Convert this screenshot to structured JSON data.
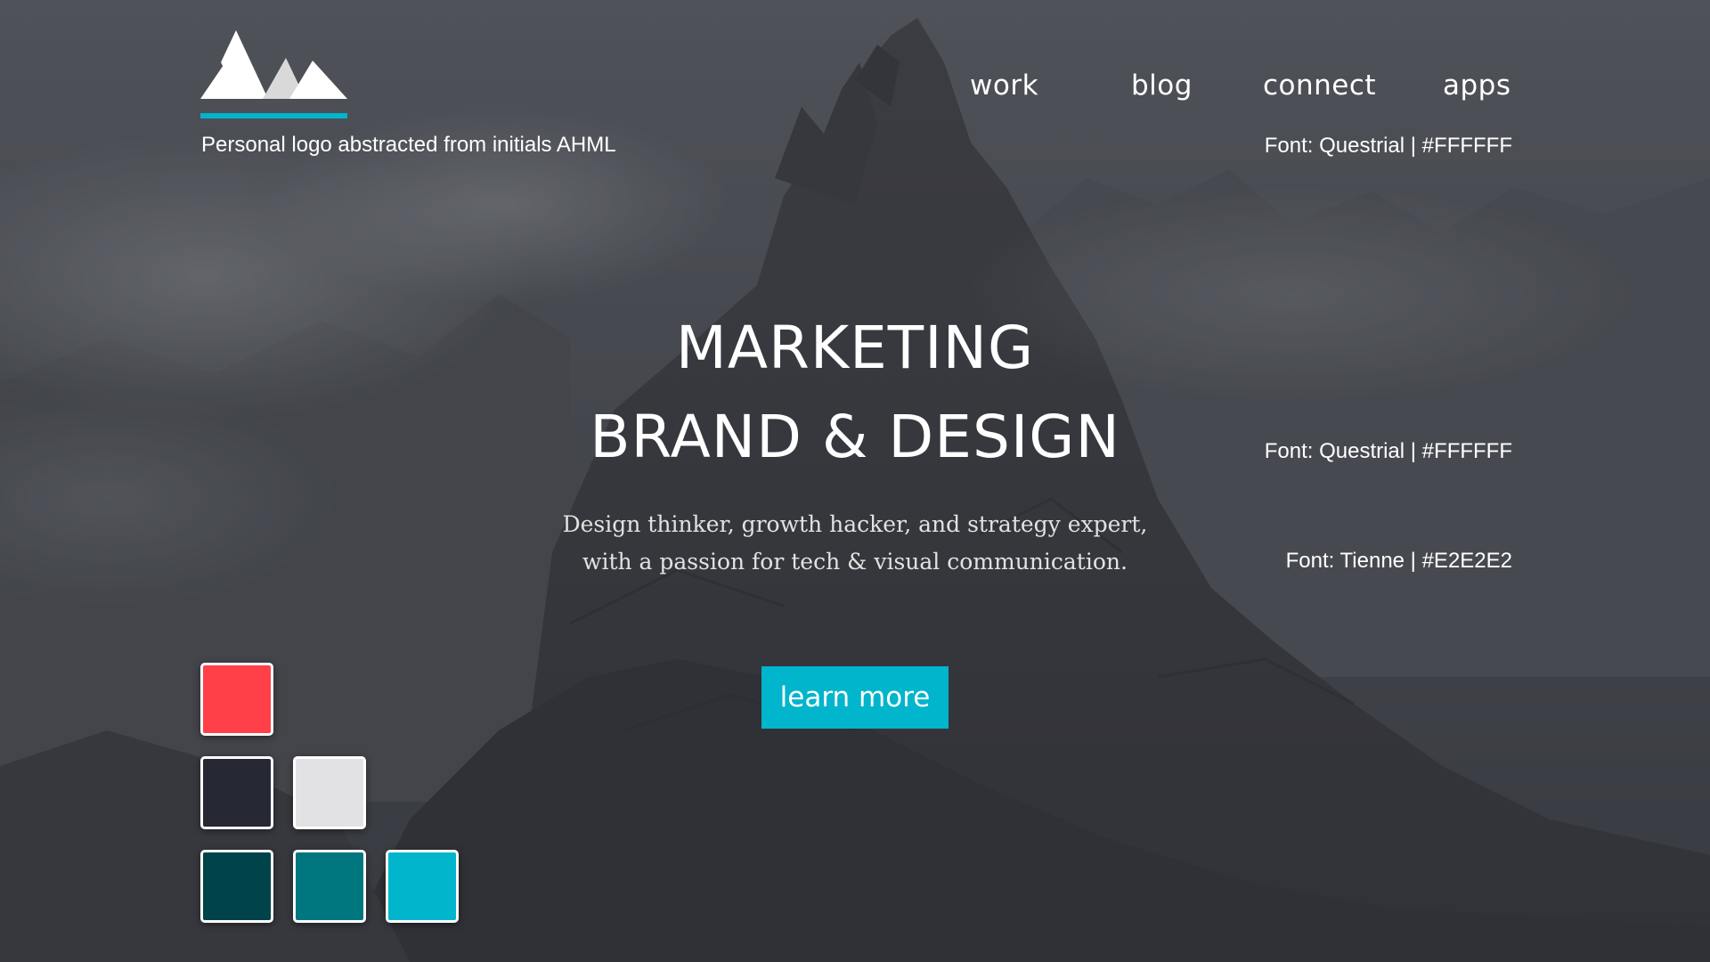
{
  "logo": {
    "icon": "mountain-logo-icon",
    "accent": "#00b5cc",
    "caption": "Personal logo abstracted from initials AHML"
  },
  "nav": {
    "items": [
      {
        "label": "work"
      },
      {
        "label": "blog"
      },
      {
        "label": "connect"
      },
      {
        "label": "apps"
      }
    ]
  },
  "annotations": {
    "nav_font": "Font: Questrial | #FFFFFF",
    "headline_font": "Font: Questrial | #FFFFFF",
    "body_font": "Font: Tienne | #E2E2E2"
  },
  "hero": {
    "line_1": "MARKETING",
    "line_2": "BRAND & DESIGN",
    "subtitle_line_1": "Design thinker, growth hacker, and strategy expert,",
    "subtitle_line_2": "with a passion for tech & visual communication.",
    "cta_label": "learn more",
    "cta_color": "#00b5cc"
  },
  "palette": {
    "swatches": [
      {
        "name": "red",
        "color": "#ff4049"
      },
      {
        "name": "dark-navy",
        "color": "#262934"
      },
      {
        "name": "light-gray",
        "color": "#e2e2e4"
      },
      {
        "name": "dark-teal",
        "color": "#00434a"
      },
      {
        "name": "teal",
        "color": "#00767f"
      },
      {
        "name": "cyan",
        "color": "#00b5cc"
      }
    ]
  },
  "background": {
    "scene": "mountain-landscape-image",
    "overlay": "#3e4148"
  }
}
